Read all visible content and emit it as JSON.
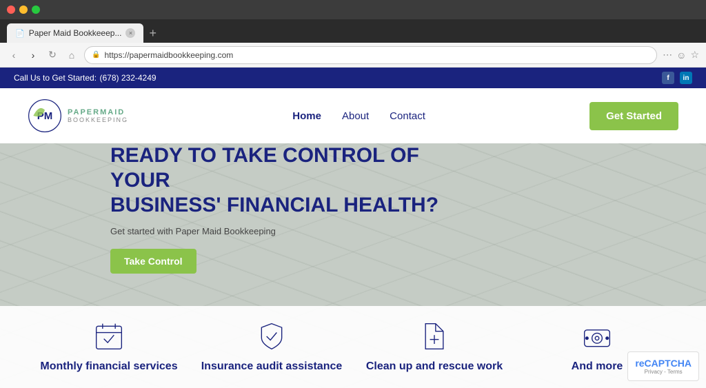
{
  "browser": {
    "tab_title": "Paper Maid Bookkeeep...",
    "url": "https://papermaidbookkeeping.com",
    "traffic_lights": [
      "red",
      "yellow",
      "green"
    ]
  },
  "topbar": {
    "cta": "Call Us to Get Started:",
    "phone": "(678) 232-4249",
    "social": [
      {
        "name": "facebook",
        "label": "f"
      },
      {
        "name": "linkedin",
        "label": "in"
      }
    ]
  },
  "header": {
    "logo_pm": "PM",
    "logo_papermaid": "PAPERMAID",
    "logo_bookkeeping": "BOOKKEEPING",
    "nav": [
      {
        "label": "Home",
        "active": true
      },
      {
        "label": "About",
        "active": false
      },
      {
        "label": "Contact",
        "active": false
      }
    ],
    "cta_button": "Get Started"
  },
  "hero": {
    "title_line1": "READY TO TAKE CONTROL OF YOUR",
    "title_line2": "BUSINESS' FINANCIAL HEALTH?",
    "subtitle": "Get started with Paper Maid Bookkeeping",
    "cta_button": "Take Control"
  },
  "services": [
    {
      "icon": "calendar-check",
      "label": "Monthly financial services"
    },
    {
      "icon": "shield-check",
      "label": "Insurance audit assistance"
    },
    {
      "icon": "file-plus",
      "label": "Clean up and rescue work"
    },
    {
      "icon": "dollar-circle",
      "label": "And more"
    }
  ],
  "recaptcha": {
    "line1": "reCAPTCHA",
    "line2": "Privacy - Terms"
  }
}
